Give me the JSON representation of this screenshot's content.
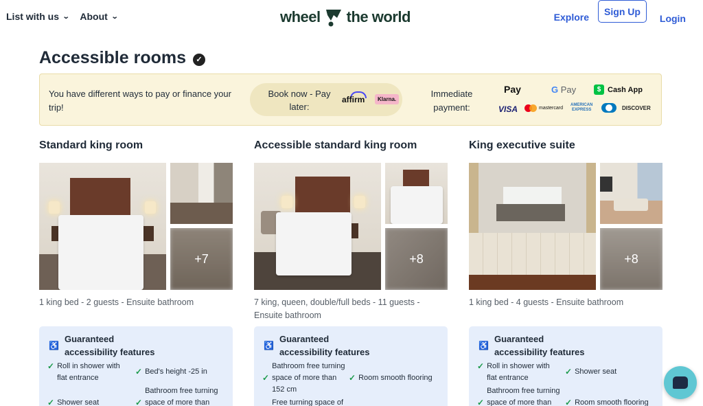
{
  "header": {
    "nav_left": [
      {
        "label": "List with us"
      },
      {
        "label": "About"
      }
    ],
    "logo_left": "wheel",
    "logo_right": "the world",
    "explore": "Explore",
    "signup": "Sign Up",
    "login": "Login"
  },
  "page": {
    "title": "Accessible rooms"
  },
  "payment": {
    "text": "You have different ways to pay or finance your trip!",
    "bnpl_label": "Book now - Pay later:",
    "affirm": "affirm",
    "klarna": "Klarna.",
    "immediate_label": "Immediate payment:",
    "apple_pay": "Pay",
    "google_pay": "Pay",
    "cash_app": "Cash App",
    "visa": "VISA",
    "mastercard": "mastercard",
    "amex_line1": "AMERICAN",
    "amex_line2": "EXPRESS",
    "discover": "DISCOVER"
  },
  "rooms": [
    {
      "title": "Standard king room",
      "more_photos": "+7",
      "meta": "1 king bed - 2 guests - Ensuite bathroom",
      "features_title": "Guaranteed accessibility features",
      "features": [
        "Roll in shower with flat entrance",
        "Bed's height -25 in",
        "Shower seat",
        "Bathroom free turning space of more than"
      ]
    },
    {
      "title": "Accessible standard king room",
      "more_photos": "+8",
      "meta": "7 king, queen, double/full beds - 11 guests - Ensuite bathroom",
      "features_title": "Guaranteed accessibility features",
      "features": [
        "Bathroom free turning space of more than 152 cm",
        "Room smooth flooring",
        "Free turning space of"
      ]
    },
    {
      "title": "King executive suite",
      "more_photos": "+8",
      "meta": "1 king bed - 4 guests - Ensuite bathroom",
      "features_title": "Guaranteed accessibility features",
      "features": [
        "Roll in shower with flat entrance",
        "Shower seat",
        "Bathroom free turning space of more than",
        "Room smooth flooring"
      ]
    }
  ],
  "icons": {
    "title_badge": "check-circle-icon",
    "wheelchair": "wheelchair-icon",
    "check": "check-icon",
    "chat": "chat-icon"
  }
}
